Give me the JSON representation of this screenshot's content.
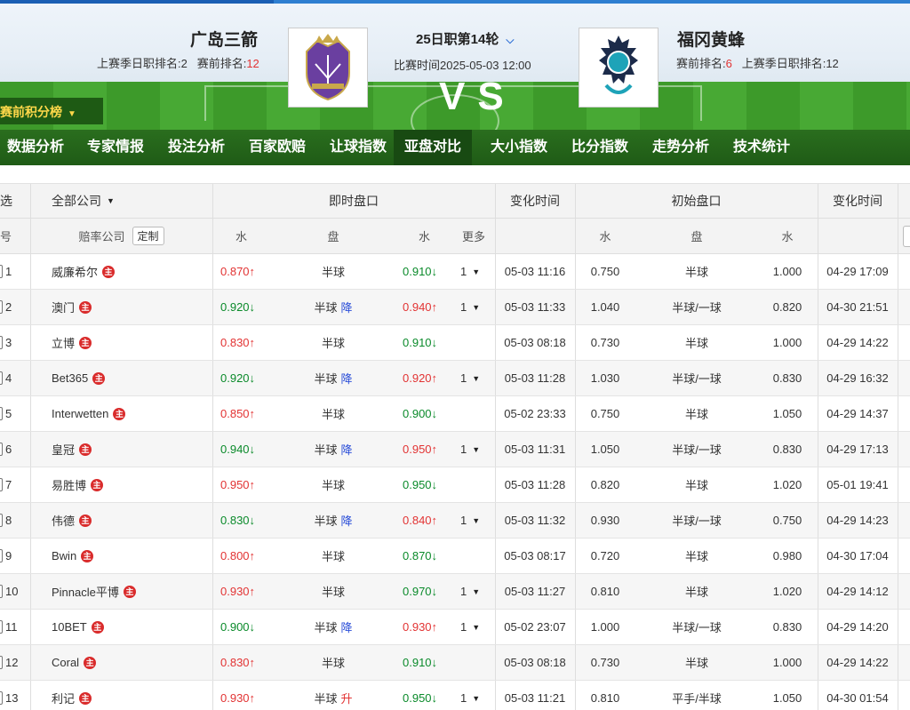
{
  "match": {
    "home_name": "广岛三箭",
    "home_rank_label1": "上赛季日职排名:",
    "home_rank_val1": "2",
    "home_rank_label2": "赛前排名:",
    "home_rank_val2": "12",
    "away_name": "福冈黄蜂",
    "away_rank_label1": "赛前排名:",
    "away_rank_val1": "6",
    "away_rank_label2": "上赛季日职排名:",
    "away_rank_val2": "12",
    "round": "25日职第14轮",
    "time": "比赛时间2025-05-03 12:00",
    "vs": "VS",
    "standings_btn": "赛前积分榜"
  },
  "nav": [
    "数据分析",
    "专家情报",
    "投注分析",
    "百家欧赔",
    "让球指数",
    "亚盘对比",
    "大小指数",
    "比分指数",
    "走势分析",
    "技术统计"
  ],
  "nav_active": 5,
  "header": {
    "select": "选",
    "company_filter": "全部公司",
    "live": "即时盘口",
    "change_time": "变化时间",
    "initial": "初始盘口",
    "change_time2": "变化时间",
    "no": "号",
    "company": "赔率公司",
    "custom": "定制",
    "water": "水",
    "pan": "盘",
    "water2": "水",
    "more": "更多",
    "i_water": "水",
    "i_pan": "盘",
    "i_water2": "水"
  },
  "colors": {
    "up": "#e23333",
    "down": "#0a8a2a",
    "nav_bg": "#1f5b16",
    "accent": "#2e7fd1"
  },
  "rows": [
    {
      "no": "1",
      "company": "威廉希尔",
      "w1": "0.870",
      "w1d": "up",
      "pan": "半球",
      "tag": "",
      "w2": "0.910",
      "w2d": "down",
      "more": "1",
      "t1": "05-03 11:16",
      "iw1": "0.750",
      "ipan": "半球",
      "iw2": "1.000",
      "t2": "04-29 17:09"
    },
    {
      "no": "2",
      "company": "澳门",
      "w1": "0.920",
      "w1d": "down",
      "pan": "半球",
      "tag": "降",
      "w2": "0.940",
      "w2d": "up",
      "more": "1",
      "t1": "05-03 11:33",
      "iw1": "1.040",
      "ipan": "半球/一球",
      "iw2": "0.820",
      "t2": "04-30 21:51"
    },
    {
      "no": "3",
      "company": "立博",
      "w1": "0.830",
      "w1d": "up",
      "pan": "半球",
      "tag": "",
      "w2": "0.910",
      "w2d": "down",
      "more": "",
      "t1": "05-03 08:18",
      "iw1": "0.730",
      "ipan": "半球",
      "iw2": "1.000",
      "t2": "04-29 14:22"
    },
    {
      "no": "4",
      "company": "Bet365",
      "w1": "0.920",
      "w1d": "down",
      "pan": "半球",
      "tag": "降",
      "w2": "0.920",
      "w2d": "up",
      "more": "1",
      "t1": "05-03 11:28",
      "iw1": "1.030",
      "ipan": "半球/一球",
      "iw2": "0.830",
      "t2": "04-29 16:32"
    },
    {
      "no": "5",
      "company": "Interwetten",
      "w1": "0.850",
      "w1d": "up",
      "pan": "半球",
      "tag": "",
      "w2": "0.900",
      "w2d": "down",
      "more": "",
      "t1": "05-02 23:33",
      "iw1": "0.750",
      "ipan": "半球",
      "iw2": "1.050",
      "t2": "04-29 14:37"
    },
    {
      "no": "6",
      "company": "皇冠",
      "w1": "0.940",
      "w1d": "down",
      "pan": "半球",
      "tag": "降",
      "w2": "0.950",
      "w2d": "up",
      "more": "1",
      "t1": "05-03 11:31",
      "iw1": "1.050",
      "ipan": "半球/一球",
      "iw2": "0.830",
      "t2": "04-29 17:13"
    },
    {
      "no": "7",
      "company": "易胜博",
      "w1": "0.950",
      "w1d": "up",
      "pan": "半球",
      "tag": "",
      "w2": "0.950",
      "w2d": "down",
      "more": "",
      "t1": "05-03 11:28",
      "iw1": "0.820",
      "ipan": "半球",
      "iw2": "1.020",
      "t2": "05-01 19:41"
    },
    {
      "no": "8",
      "company": "伟德",
      "w1": "0.830",
      "w1d": "down",
      "pan": "半球",
      "tag": "降",
      "w2": "0.840",
      "w2d": "up",
      "more": "1",
      "t1": "05-03 11:32",
      "iw1": "0.930",
      "ipan": "半球/一球",
      "iw2": "0.750",
      "t2": "04-29 14:23"
    },
    {
      "no": "9",
      "company": "Bwin",
      "w1": "0.800",
      "w1d": "up",
      "pan": "半球",
      "tag": "",
      "w2": "0.870",
      "w2d": "down",
      "more": "",
      "t1": "05-03 08:17",
      "iw1": "0.720",
      "ipan": "半球",
      "iw2": "0.980",
      "t2": "04-30 17:04"
    },
    {
      "no": "10",
      "company": "Pinnacle平博",
      "w1": "0.930",
      "w1d": "up",
      "pan": "半球",
      "tag": "",
      "w2": "0.970",
      "w2d": "down",
      "more": "1",
      "t1": "05-03 11:27",
      "iw1": "0.810",
      "ipan": "半球",
      "iw2": "1.020",
      "t2": "04-29 14:12"
    },
    {
      "no": "11",
      "company": "10BET",
      "w1": "0.900",
      "w1d": "down",
      "pan": "半球",
      "tag": "降",
      "w2": "0.930",
      "w2d": "up",
      "more": "1",
      "t1": "05-02 23:07",
      "iw1": "1.000",
      "ipan": "半球/一球",
      "iw2": "0.830",
      "t2": "04-29 14:20"
    },
    {
      "no": "12",
      "company": "Coral",
      "w1": "0.830",
      "w1d": "up",
      "pan": "半球",
      "tag": "",
      "w2": "0.910",
      "w2d": "down",
      "more": "",
      "t1": "05-03 08:18",
      "iw1": "0.730",
      "ipan": "半球",
      "iw2": "1.000",
      "t2": "04-29 14:22"
    },
    {
      "no": "13",
      "company": "利记",
      "w1": "0.930",
      "w1d": "up",
      "pan": "半球",
      "tag": "升",
      "w2": "0.950",
      "w2d": "down",
      "more": "1",
      "t1": "05-03 11:21",
      "iw1": "0.810",
      "ipan": "平手/半球",
      "iw2": "1.050",
      "t2": "04-30 01:54"
    }
  ],
  "badge_char": "主"
}
